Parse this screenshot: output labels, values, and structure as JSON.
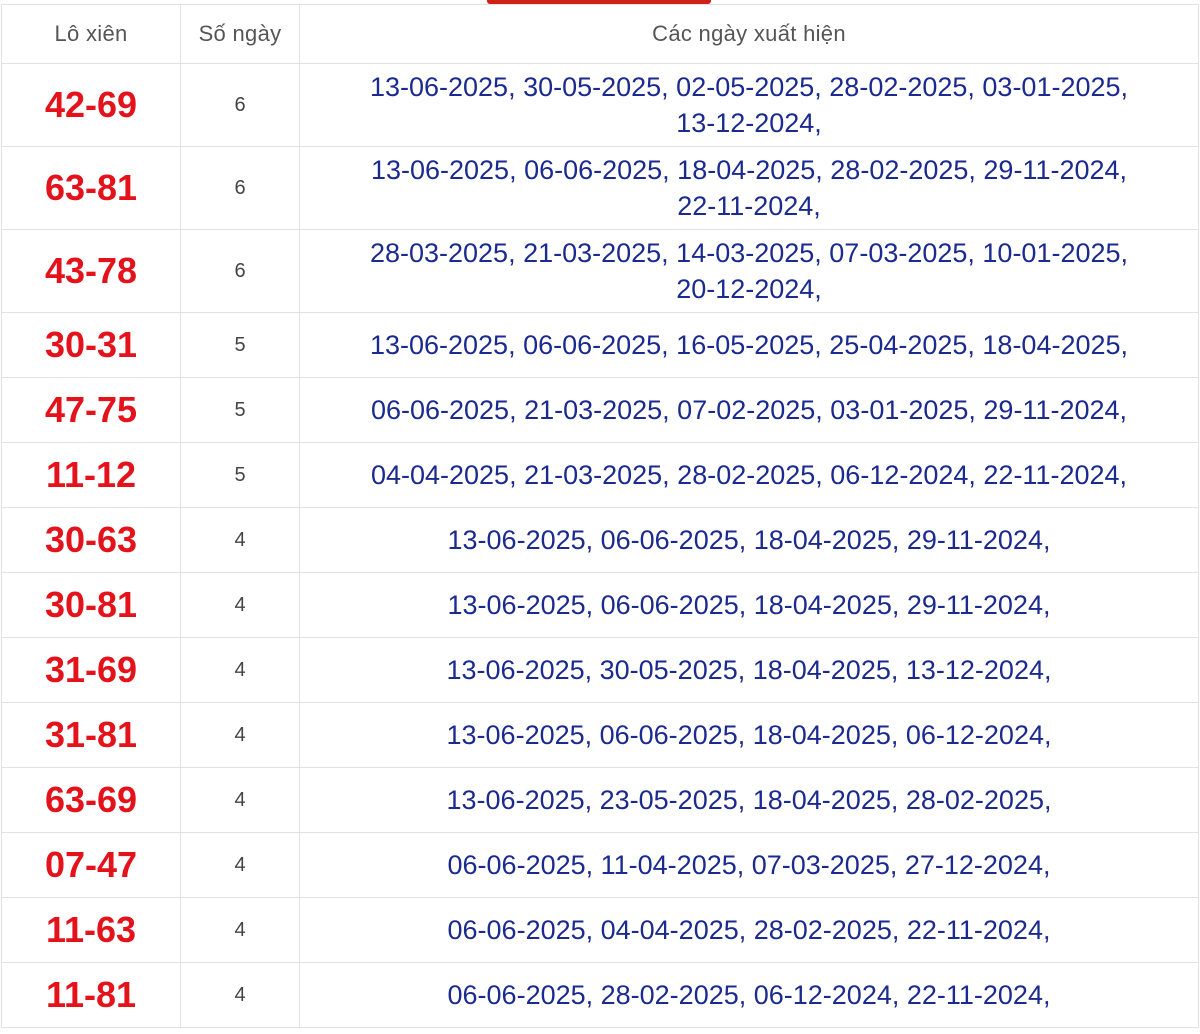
{
  "table": {
    "headers": [
      "Lô xiên",
      "Số ngày",
      "Các ngày xuất hiện"
    ],
    "rows": [
      {
        "pair": "42-69",
        "count": "6",
        "dates_line1": "13-06-2025, 30-05-2025, 02-05-2025, 28-02-2025, 03-01-2025,",
        "dates_line2": "13-12-2024,"
      },
      {
        "pair": "63-81",
        "count": "6",
        "dates_line1": "13-06-2025, 06-06-2025, 18-04-2025, 28-02-2025, 29-11-2024,",
        "dates_line2": "22-11-2024,"
      },
      {
        "pair": "43-78",
        "count": "6",
        "dates_line1": "28-03-2025, 21-03-2025, 14-03-2025, 07-03-2025, 10-01-2025,",
        "dates_line2": "20-12-2024,"
      },
      {
        "pair": "30-31",
        "count": "5",
        "dates_line1": "13-06-2025, 06-06-2025, 16-05-2025, 25-04-2025, 18-04-2025,",
        "dates_line2": ""
      },
      {
        "pair": "47-75",
        "count": "5",
        "dates_line1": "06-06-2025, 21-03-2025, 07-02-2025, 03-01-2025, 29-11-2024,",
        "dates_line2": ""
      },
      {
        "pair": "11-12",
        "count": "5",
        "dates_line1": "04-04-2025, 21-03-2025, 28-02-2025, 06-12-2024, 22-11-2024,",
        "dates_line2": ""
      },
      {
        "pair": "30-63",
        "count": "4",
        "dates_line1": "13-06-2025, 06-06-2025, 18-04-2025, 29-11-2024,",
        "dates_line2": ""
      },
      {
        "pair": "30-81",
        "count": "4",
        "dates_line1": "13-06-2025, 06-06-2025, 18-04-2025, 29-11-2024,",
        "dates_line2": ""
      },
      {
        "pair": "31-69",
        "count": "4",
        "dates_line1": "13-06-2025, 30-05-2025, 18-04-2025, 13-12-2024,",
        "dates_line2": ""
      },
      {
        "pair": "31-81",
        "count": "4",
        "dates_line1": "13-06-2025, 06-06-2025, 18-04-2025, 06-12-2024,",
        "dates_line2": ""
      },
      {
        "pair": "63-69",
        "count": "4",
        "dates_line1": "13-06-2025, 23-05-2025, 18-04-2025, 28-02-2025,",
        "dates_line2": ""
      },
      {
        "pair": "07-47",
        "count": "4",
        "dates_line1": "06-06-2025, 11-04-2025, 07-03-2025, 27-12-2024,",
        "dates_line2": ""
      },
      {
        "pair": "11-63",
        "count": "4",
        "dates_line1": "06-06-2025, 04-04-2025, 28-02-2025, 22-11-2024,",
        "dates_line2": ""
      },
      {
        "pair": "11-81",
        "count": "4",
        "dates_line1": "06-06-2025, 28-02-2025, 06-12-2024, 22-11-2024,",
        "dates_line2": ""
      }
    ]
  },
  "colors": {
    "pair_red": "#e3121b",
    "date_blue": "#1b2a8f",
    "tab_red": "#d0201a"
  }
}
